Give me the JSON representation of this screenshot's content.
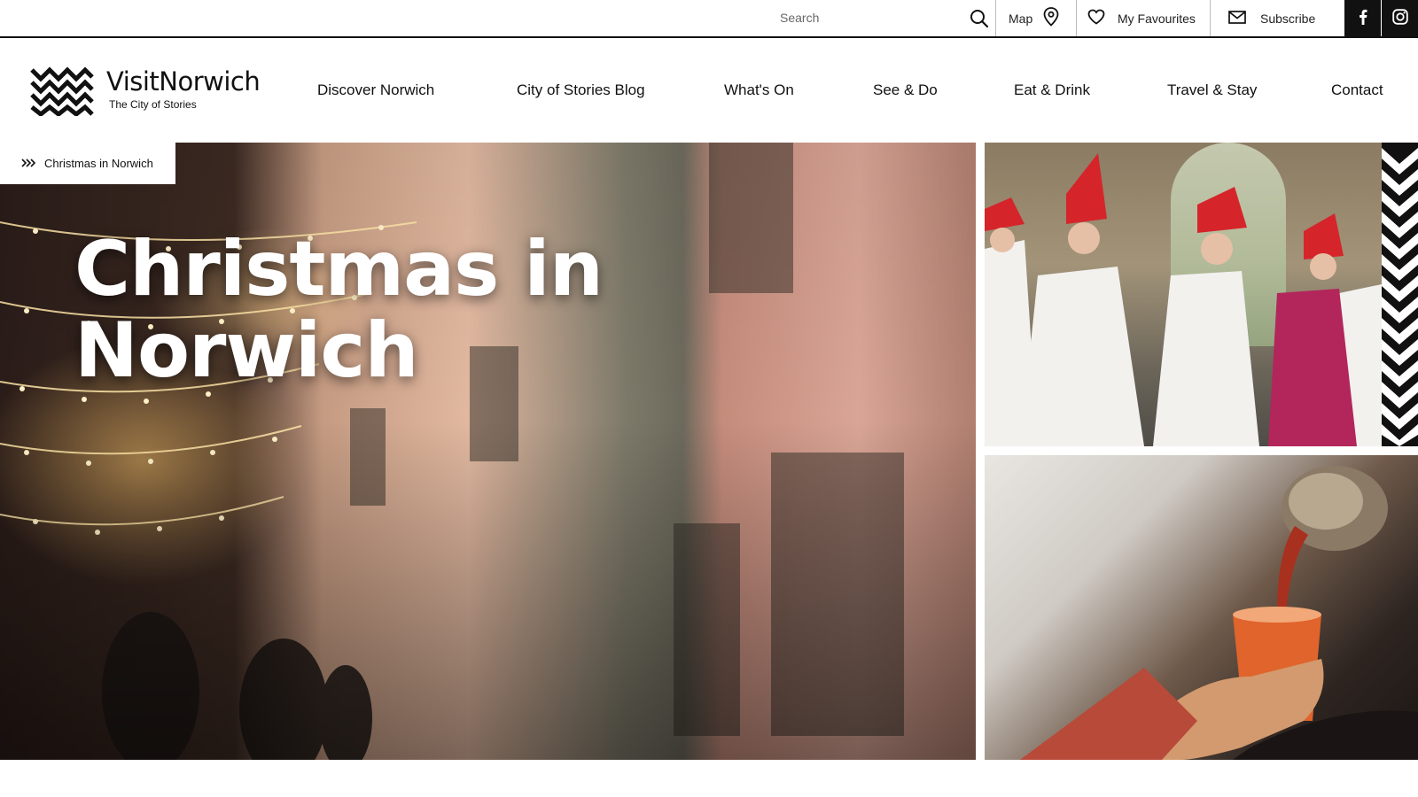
{
  "utility": {
    "search_placeholder": "Search",
    "map_label": "Map",
    "favourites_label": "My Favourites",
    "subscribe_label": "Subscribe",
    "social": [
      "facebook-icon",
      "instagram-icon"
    ]
  },
  "logo": {
    "name": "VisitNorwich",
    "tagline": "The City of Stories"
  },
  "nav": {
    "items": [
      "Discover Norwich",
      "City of Stories Blog",
      "What's On",
      "See & Do",
      "Eat & Drink",
      "Travel & Stay",
      "Contact"
    ]
  },
  "hero": {
    "breadcrumb": "Christmas in Norwich",
    "title": "Christmas in Norwich"
  },
  "colors": {
    "text": "#111111",
    "social_bg": "#111111",
    "background": "#ffffff"
  }
}
